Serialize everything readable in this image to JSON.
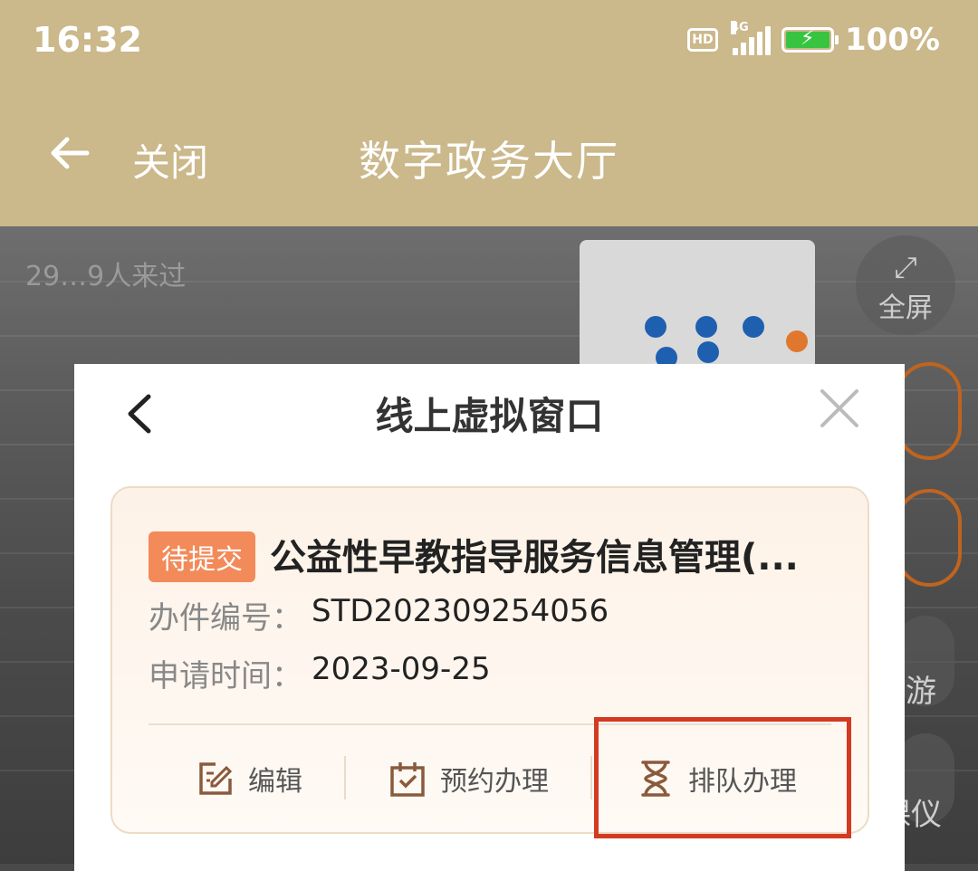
{
  "status": {
    "time": "16:32",
    "network": "4G",
    "battery": "100%"
  },
  "appbar": {
    "close_label": "关闭",
    "title": "数字政务大厅"
  },
  "background": {
    "visitors": "29…9人来过",
    "fullscreen_label": "全屏",
    "side_text_1": "游",
    "side_text_2": "课仪"
  },
  "dialog": {
    "title": "线上虚拟窗口",
    "card": {
      "status_badge": "待提交",
      "title": "公益性早教指导服务信息管理(...",
      "case_no_label": "办件编号：",
      "case_no": "STD202309254056",
      "apply_time_label": "申请时间：",
      "apply_time": "2023-09-25",
      "actions": [
        {
          "label": "编辑",
          "icon": "edit-icon"
        },
        {
          "label": "预约办理",
          "icon": "calendar-check-icon"
        },
        {
          "label": "排队办理",
          "icon": "hourglass-icon"
        }
      ]
    }
  },
  "colors": {
    "header": "#cbb88b",
    "badge": "#f28a5a",
    "highlight": "#d43a22"
  }
}
